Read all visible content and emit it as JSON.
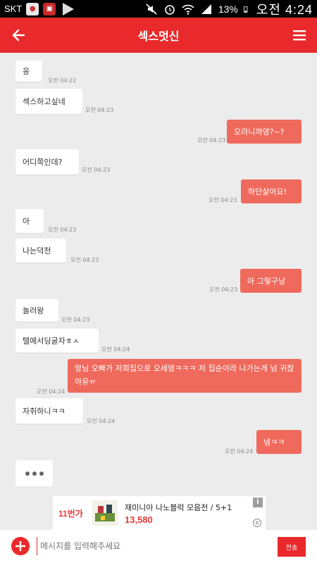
{
  "status_bar": {
    "carrier": "SKT",
    "battery": "13%",
    "time": "오전 4:24"
  },
  "header": {
    "title": "섹스멋신"
  },
  "messages": [
    {
      "dir": "in",
      "text": "응",
      "time": "오전 04:22"
    },
    {
      "dir": "in",
      "text": "섹스하고싶네",
      "time": "오전 04:23"
    },
    {
      "dir": "out",
      "text": "오라니까영?~?",
      "time": "오전 04:23"
    },
    {
      "dir": "in",
      "text": "어디쪽인데?",
      "time": "오전 04:23"
    },
    {
      "dir": "out",
      "text": "하단살아요!",
      "time": "오전 04:23"
    },
    {
      "dir": "in",
      "text": "아",
      "time": "오전 04:23"
    },
    {
      "dir": "in",
      "text": "나는덕천",
      "time": "오전 04:23"
    },
    {
      "dir": "out",
      "text": "아 그렇구낭",
      "time": "오전 04:23"
    },
    {
      "dir": "in",
      "text": "놀러왕",
      "time": "오전 04:23"
    },
    {
      "dir": "in",
      "text": "텔에서딩굴자ㅎㅅ",
      "time": "오전 04:24"
    },
    {
      "dir": "out",
      "text": "앙님 오빠가 저희집으로 오세영ㅋㅋㅋ 저 집순이라 나가는게 넘 귀찮아유ㅠ",
      "time": "오전 04:24"
    },
    {
      "dir": "in",
      "text": "자취하니ㅋㅋ",
      "time": "오전 04:24"
    },
    {
      "dir": "out",
      "text": "넹ㅋㅋ",
      "time": "오전 04:24"
    }
  ],
  "ad": {
    "logo": "11번가",
    "title": "재미니아 나노블럭 모음전 / 5+1",
    "price": "13,580",
    "info": "i"
  },
  "input": {
    "placeholder": "메시지를 입력해주세요",
    "send_label": "전송"
  }
}
